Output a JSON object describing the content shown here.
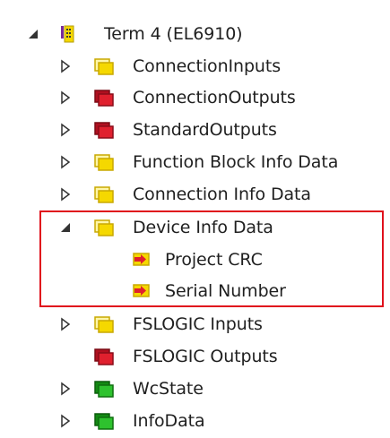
{
  "tree": {
    "root": {
      "label": "Term 4 (EL6910)",
      "expanded": true,
      "icon": "terminal-module-icon"
    },
    "items": [
      {
        "label": "ConnectionInputs",
        "icon": "yellow-folder-icon",
        "expanded": false
      },
      {
        "label": "ConnectionOutputs",
        "icon": "red-folder-icon",
        "expanded": false
      },
      {
        "label": "StandardOutputs",
        "icon": "red-folder-icon",
        "expanded": false
      },
      {
        "label": "Function Block Info Data",
        "icon": "yellow-folder-icon",
        "expanded": false
      },
      {
        "label": "Connection Info Data",
        "icon": "yellow-folder-icon",
        "expanded": false
      },
      {
        "label": "Device Info Data",
        "icon": "yellow-folder-icon",
        "expanded": true,
        "children": [
          {
            "label": "Project CRC",
            "icon": "input-variable-icon"
          },
          {
            "label": "Serial Number",
            "icon": "input-variable-icon"
          }
        ]
      },
      {
        "label": "FSLOGIC Inputs",
        "icon": "yellow-folder-icon",
        "expanded": false
      },
      {
        "label": "FSLOGIC Outputs",
        "icon": "red-folder-icon",
        "expanded": null
      },
      {
        "label": "WcState",
        "icon": "green-folder-icon",
        "expanded": false
      },
      {
        "label": "InfoData",
        "icon": "green-folder-icon",
        "expanded": false
      }
    ]
  },
  "colors": {
    "highlight_border": "#e0101c",
    "yellow_folder": "#f5d800",
    "red_folder": "#c8102e",
    "green_folder": "#1fa51f"
  }
}
